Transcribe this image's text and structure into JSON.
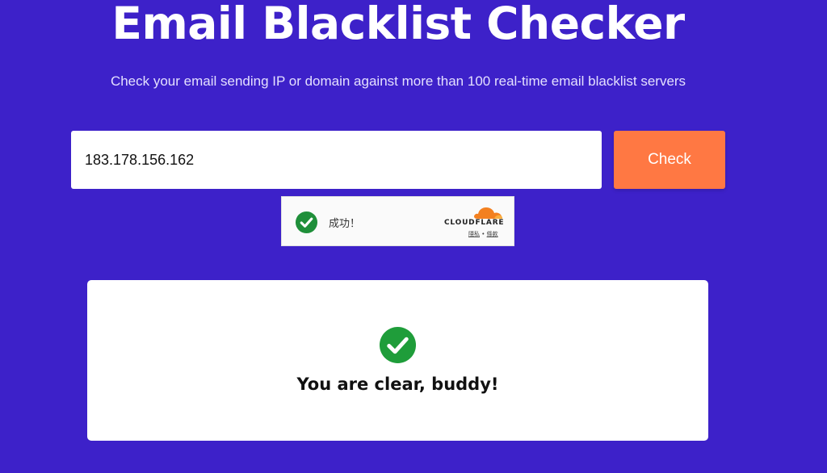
{
  "header": {
    "title": "Email Blacklist Checker",
    "subtitle": "Check your email sending IP or domain against more than 100 real-time email blacklist servers"
  },
  "search": {
    "value": "183.178.156.162",
    "button_label": "Check"
  },
  "captcha": {
    "status": "成功！",
    "brand": "CLOUDFLARE",
    "privacy_link": "隱私",
    "separator": "•",
    "terms_link": "條款",
    "icon": "check-circle-icon",
    "brand_color": "#f38020"
  },
  "result": {
    "icon": "check-circle-icon",
    "message": "You are clear, buddy!",
    "icon_color": "#1f9d3a"
  },
  "colors": {
    "background": "#3d21c9",
    "accent": "#ff7843",
    "success": "#1f9d3a"
  }
}
